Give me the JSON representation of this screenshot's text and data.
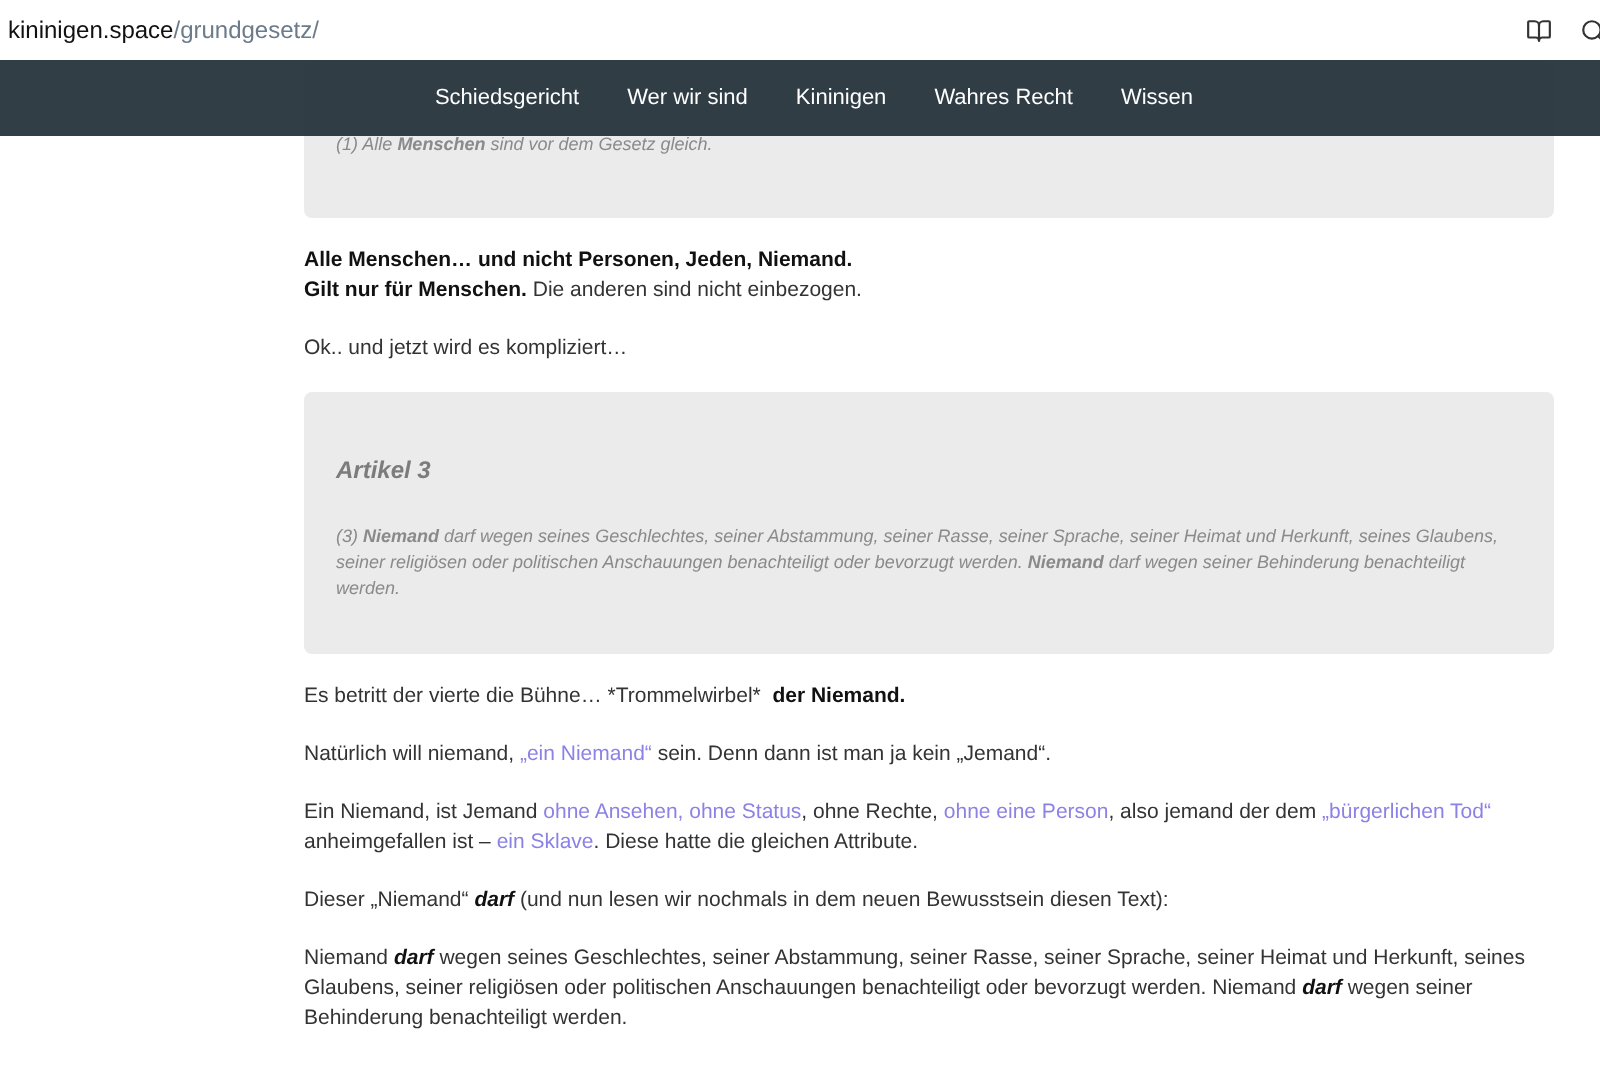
{
  "address_bar": {
    "domain": "kininigen.space",
    "path": "/grundgesetz/"
  },
  "nav": {
    "items": [
      "Schiedsgericht",
      "Wer wir sind",
      "Kininigen",
      "Wahres Recht",
      "Wissen"
    ]
  },
  "content": [
    {
      "kind": "quote",
      "text": "(1) Alle **Menschen** sind vor dem Gesetz gleich."
    },
    {
      "kind": "paragraph",
      "segments": [
        {
          "kind": "bold",
          "text": "Alle Menschen… und nicht Personen, Jeden, Niemand."
        },
        {
          "kind": "break"
        },
        {
          "kind": "bold",
          "text": "Gilt nur für Menschen."
        },
        {
          "kind": "text",
          "text": " Die anderen sind nicht einbezogen."
        }
      ]
    },
    {
      "kind": "paragraph",
      "segments": [
        {
          "kind": "text",
          "text": "Ok.. und jetzt wird es kompliziert…"
        }
      ]
    },
    {
      "kind": "quote",
      "title": "Artikel 3",
      "text": "(3) **Niemand** darf wegen seines Geschlechtes, seiner Abstammung, seiner Rasse, seiner Sprache, seiner Heimat und Herkunft, seines Glaubens, seiner religiösen oder politischen Anschauungen benachteiligt oder bevorzugt werden. **Niemand** darf wegen seiner Behinderung benachteiligt werden."
    },
    {
      "kind": "paragraph",
      "segments": [
        {
          "kind": "text",
          "text": "Es betritt der vierte die Bühne… *Trommelwirbel*  "
        },
        {
          "kind": "bold",
          "text": "der Niemand."
        }
      ]
    },
    {
      "kind": "paragraph",
      "segments": [
        {
          "kind": "text",
          "text": "Natürlich will niemand, "
        },
        {
          "kind": "link",
          "text": "„ein Niemand“"
        },
        {
          "kind": "text",
          "text": " sein. Denn dann ist man ja kein „Jemand“."
        }
      ]
    },
    {
      "kind": "paragraph",
      "segments": [
        {
          "kind": "text",
          "text": "Ein Niemand, ist Jemand "
        },
        {
          "kind": "link",
          "text": "ohne Ansehen, ohne Status"
        },
        {
          "kind": "text",
          "text": ", ohne Rechte, "
        },
        {
          "kind": "link",
          "text": "ohne eine Person"
        },
        {
          "kind": "text",
          "text": ", also jemand der dem "
        },
        {
          "kind": "link",
          "text": "„bürgerlichen Tod“"
        },
        {
          "kind": "text",
          "text": " anheimgefallen ist – "
        },
        {
          "kind": "link",
          "text": "ein Sklave"
        },
        {
          "kind": "text",
          "text": ". Diese hatte die gleichen Attribute."
        }
      ]
    },
    {
      "kind": "paragraph",
      "segments": [
        {
          "kind": "text",
          "text": "Dieser „Niemand“ "
        },
        {
          "kind": "emphasis",
          "text": "darf"
        },
        {
          "kind": "text",
          "text": " (und nun lesen wir nochmals in dem neuen Bewusstsein diesen Text):"
        }
      ]
    },
    {
      "kind": "paragraph",
      "segments": [
        {
          "kind": "text",
          "text": "Niemand "
        },
        {
          "kind": "emphasis",
          "text": "darf"
        },
        {
          "kind": "text",
          "text": " wegen seines Geschlechtes, seiner Abstammung, seiner Rasse, seiner Sprache, seiner Heimat und Herkunft, seines Glaubens, seiner religiösen oder politischen Anschauungen benachteiligt oder bevorzugt werden. Niemand "
        },
        {
          "kind": "emphasis",
          "text": "darf"
        },
        {
          "kind": "text",
          "text": " wegen seiner Behinderung benachteiligt werden."
        }
      ]
    }
  ]
}
